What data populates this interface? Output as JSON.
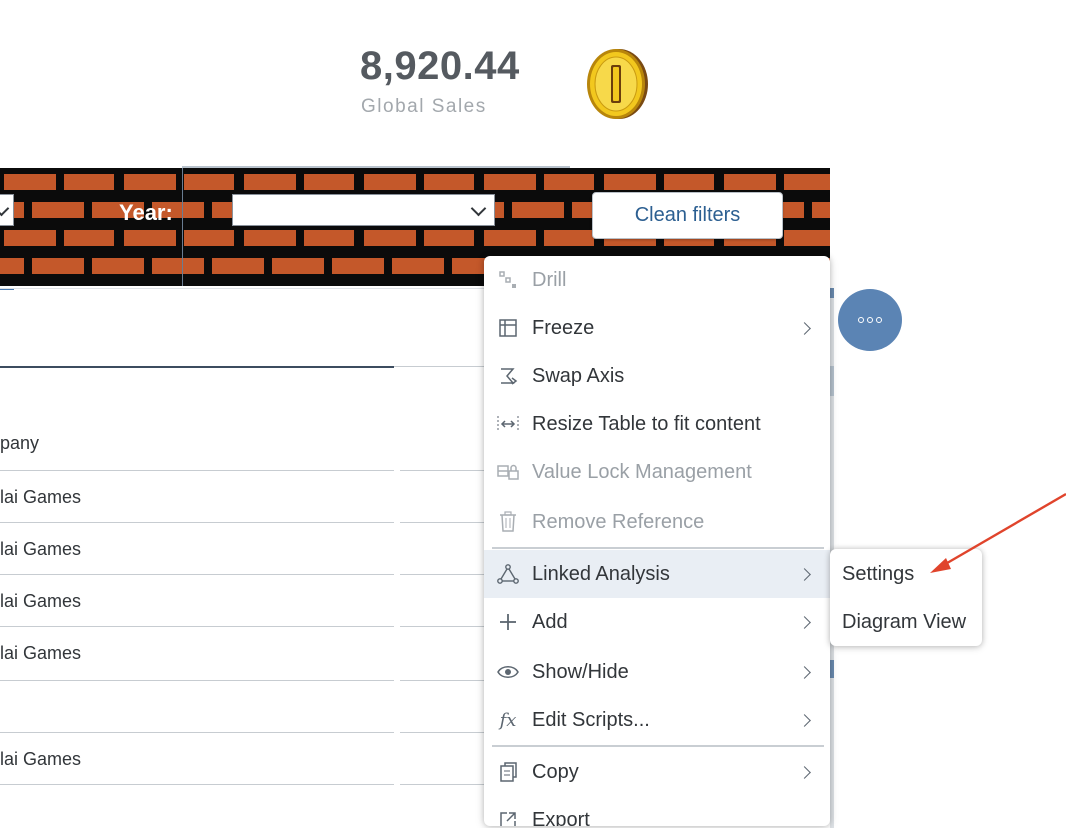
{
  "kpi": {
    "value": "8,920.44",
    "label": "Global Sales"
  },
  "filters": {
    "year_label": "Year:",
    "year_value": "",
    "clean_button": "Clean filters"
  },
  "table": {
    "rows": [
      "pany",
      "lai Games",
      "lai Games",
      "lai Games",
      "lai Games",
      "",
      "lai Games"
    ]
  },
  "context_menu": {
    "items": [
      {
        "label": "Drill",
        "icon": "drill-icon",
        "disabled": true,
        "submenu": false
      },
      {
        "label": "Freeze",
        "icon": "freeze-icon",
        "disabled": false,
        "submenu": true
      },
      {
        "label": "Swap Axis",
        "icon": "swap-axis-icon",
        "disabled": false,
        "submenu": false
      },
      {
        "label": "Resize Table to fit content",
        "icon": "resize-icon",
        "disabled": false,
        "submenu": false
      },
      {
        "label": "Value Lock Management",
        "icon": "value-lock-icon",
        "disabled": true,
        "submenu": false
      },
      {
        "label": "Remove Reference",
        "icon": "trash-icon",
        "disabled": true,
        "submenu": false
      },
      {
        "label": "Linked Analysis",
        "icon": "linked-analysis-icon",
        "disabled": false,
        "submenu": true,
        "active": true
      },
      {
        "label": "Add",
        "icon": "plus-icon",
        "disabled": false,
        "submenu": true
      },
      {
        "label": "Show/Hide",
        "icon": "eye-icon",
        "disabled": false,
        "submenu": true
      },
      {
        "label": "Edit Scripts...",
        "icon": "fx-icon",
        "disabled": false,
        "submenu": true
      },
      {
        "label": "Copy",
        "icon": "copy-icon",
        "disabled": false,
        "submenu": true
      },
      {
        "label": "Export",
        "icon": "export-icon",
        "disabled": false,
        "submenu": false
      }
    ]
  },
  "submenu": {
    "items": [
      "Settings",
      "Diagram View"
    ]
  },
  "colors": {
    "accent": "#5b84b4",
    "brick": "#c4582a",
    "annotation_arrow": "#e0442c",
    "button_text": "#2c5f91"
  }
}
